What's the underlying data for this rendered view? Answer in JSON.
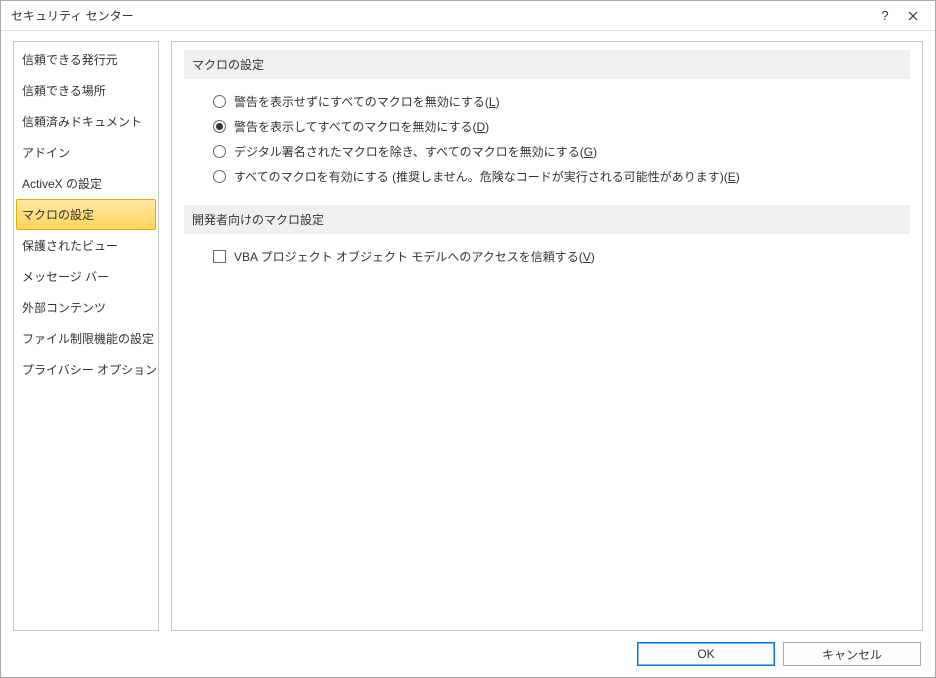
{
  "window": {
    "title": "セキュリティ センター"
  },
  "sidebar": {
    "items": [
      {
        "label": "信頼できる発行元"
      },
      {
        "label": "信頼できる場所"
      },
      {
        "label": "信頼済みドキュメント"
      },
      {
        "label": "アドイン"
      },
      {
        "label": "ActiveX の設定"
      },
      {
        "label": "マクロの設定"
      },
      {
        "label": "保護されたビュー"
      },
      {
        "label": "メッセージ バー"
      },
      {
        "label": "外部コンテンツ"
      },
      {
        "label": "ファイル制限機能の設定"
      },
      {
        "label": "プライバシー オプション"
      }
    ],
    "selected_index": 5
  },
  "sections": {
    "macro": {
      "header": "マクロの設定",
      "options": [
        {
          "text": "警告を表示せずにすべてのマクロを無効にする(",
          "accel": "L",
          "suffix": ")"
        },
        {
          "text": "警告を表示してすべてのマクロを無効にする(",
          "accel": "D",
          "suffix": ")"
        },
        {
          "text": "デジタル署名されたマクロを除き、すべてのマクロを無効にする(",
          "accel": "G",
          "suffix": ")"
        },
        {
          "text": "すべてのマクロを有効にする (推奨しません。危険なコードが実行される可能性があります)(",
          "accel": "E",
          "suffix": ")"
        }
      ],
      "selected_index": 1
    },
    "dev": {
      "header": "開発者向けのマクロ設定",
      "checkbox": {
        "text": "VBA プロジェクト オブジェクト モデルへのアクセスを信頼する(",
        "accel": "V",
        "suffix": ")",
        "checked": false
      }
    }
  },
  "buttons": {
    "ok": "OK",
    "cancel": "キャンセル"
  }
}
